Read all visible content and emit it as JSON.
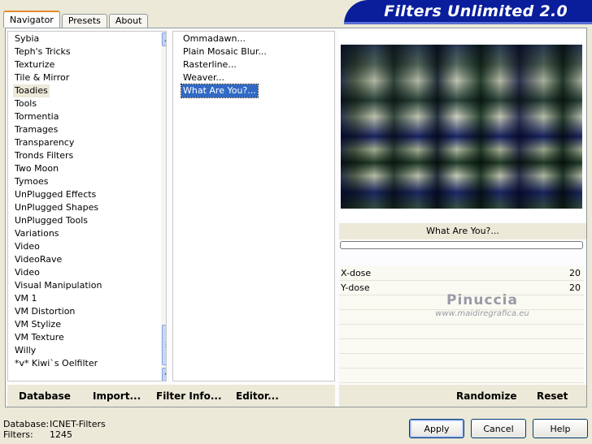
{
  "tabs": [
    "Navigator",
    "Presets",
    "About"
  ],
  "app_title": "Filters Unlimited 2.0",
  "categories": [
    "Sybia",
    "Teph's Tricks",
    "Texturize",
    "Tile & Mirror",
    "Toadies",
    "Tools",
    "Tormentia",
    "Tramages",
    "Transparency",
    "Tronds Filters",
    "Two Moon",
    "Tymoes",
    "UnPlugged Effects",
    "UnPlugged Shapes",
    "UnPlugged Tools",
    "Variations",
    "Video",
    "VideoRave",
    "Video",
    "Visual Manipulation",
    "VM 1",
    "VM Distortion",
    "VM Stylize",
    "VM Texture",
    "Willy",
    "*v* Kiwi`s Oelfilter"
  ],
  "selected_category": "Toadies",
  "filters": [
    "Ommadawn...",
    "Plain Mosaic Blur...",
    "Rasterline...",
    "Weaver...",
    "What Are You?..."
  ],
  "selected_filter": "What Are You?...",
  "filter_title": "What Are You?...",
  "params": [
    {
      "name": "X-dose",
      "value": "20"
    },
    {
      "name": "Y-dose",
      "value": "20"
    }
  ],
  "watermark": {
    "line1": "Pinuccia",
    "line2": "www.maidiregrafica.eu"
  },
  "left_buttons": {
    "database": "Database",
    "import": "Import...",
    "filter_info": "Filter Info...",
    "editor": "Editor..."
  },
  "right_buttons": {
    "randomize": "Randomize",
    "reset": "Reset"
  },
  "status": {
    "database_label": "Database:",
    "database_value": "ICNET-Filters",
    "filters_label": "Filters:",
    "filters_value": "1245"
  },
  "dialog_buttons": {
    "apply": "Apply",
    "cancel": "Cancel",
    "help": "Help"
  }
}
